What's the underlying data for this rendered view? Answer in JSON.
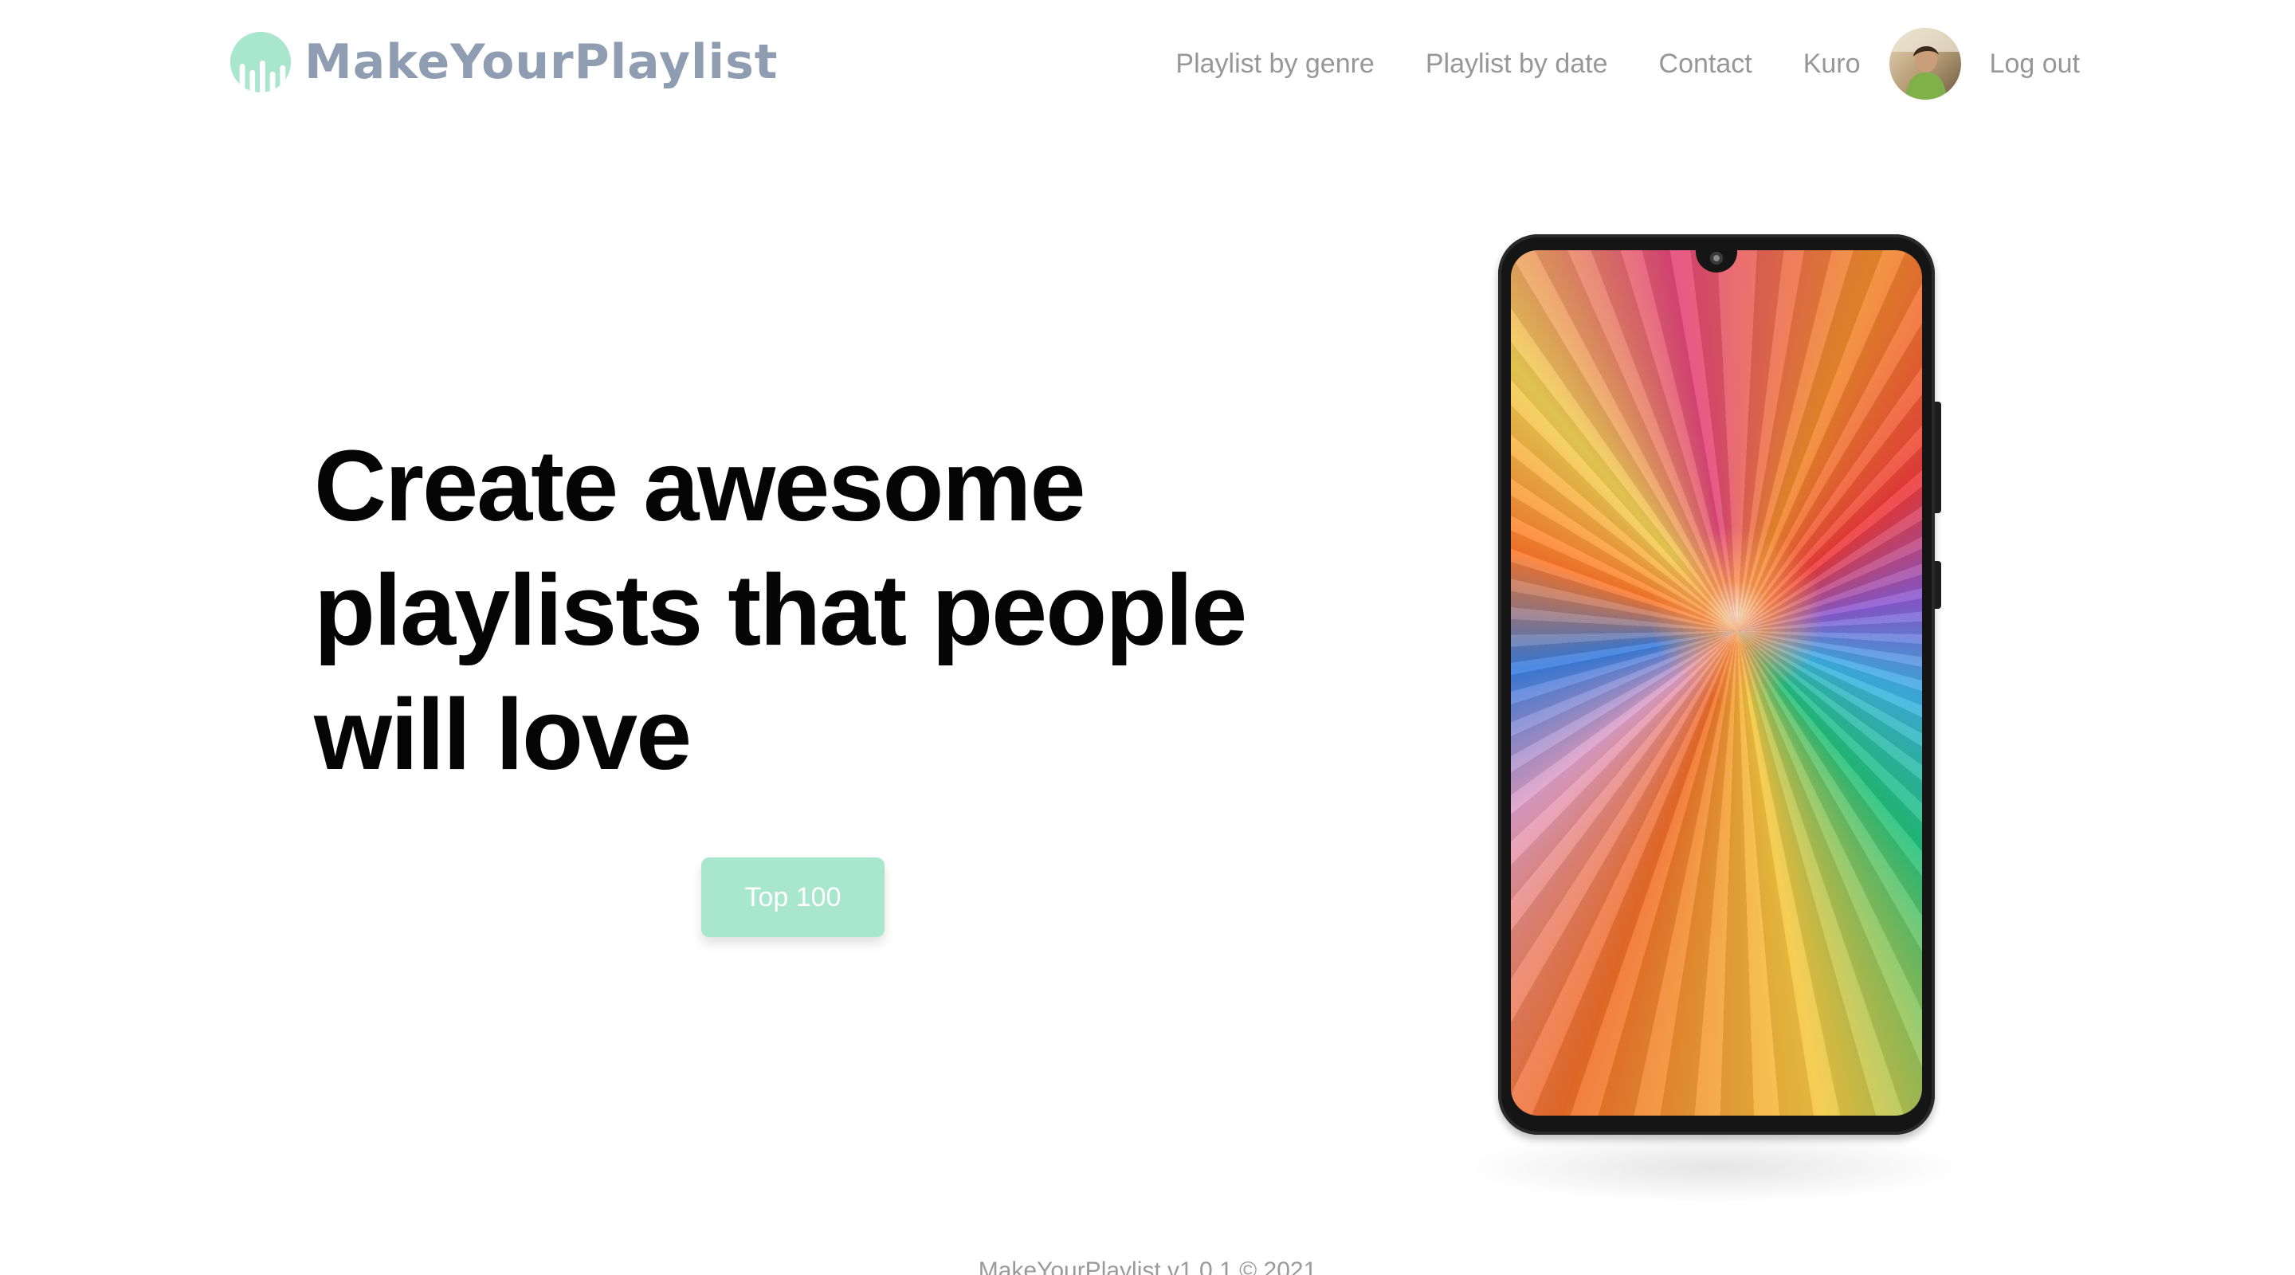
{
  "brand": {
    "name": "MakeYourPlaylist",
    "color": "#8e9db2",
    "mark_color": "#a8e6cd",
    "icon": "equalizer-logo-icon"
  },
  "nav": {
    "playlist_by_genre": "Playlist by genre",
    "playlist_by_date": "Playlist by date",
    "contact": "Contact",
    "username": "Kuro",
    "logout": "Log out",
    "link_color": "#979797"
  },
  "hero": {
    "headline": "Create awesome playlists that people will love",
    "cta_label": "Top 100",
    "cta_color": "#a8e6cd",
    "image": "phone-mockup-colorful-swirl"
  },
  "footer": {
    "text": "MakeYourPlaylist v1.0.1 © 2021"
  }
}
